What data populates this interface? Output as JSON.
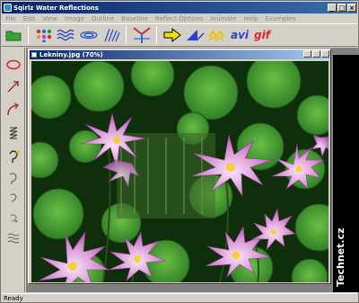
{
  "window": {
    "title": "Sqirlz Water Reflections",
    "controls": [
      "_",
      "□",
      "×"
    ]
  },
  "menu": [
    "File",
    "Edit",
    "View",
    "Image",
    "Outline",
    "Baseline",
    "Reflect Options",
    "Animate",
    "Help",
    "Examples"
  ],
  "toolbar": {
    "buttons": [
      "open-folder",
      "palette",
      "water-waves",
      "ripple",
      "reeds",
      "reflect",
      "arrow-right",
      "play-triangle",
      "waves-yellow"
    ],
    "avi_label": "avi",
    "gif_label": "gif"
  },
  "left_tools": [
    "ellipse",
    "line-arrow",
    "curve-arrow",
    "zigzag",
    "lasso",
    "hook",
    "hook-small",
    "hook-tiny",
    "wave-lines"
  ],
  "document": {
    "title": "Lekniny.jpg  (70%)"
  },
  "watermark": "Technet.cz",
  "status": "Ready",
  "colors": {
    "titlebar": "#0a246a",
    "face": "#d4d0c8",
    "workspace": "#808080",
    "leaf": "#3f8f2c",
    "flower": "#c77dc6"
  }
}
